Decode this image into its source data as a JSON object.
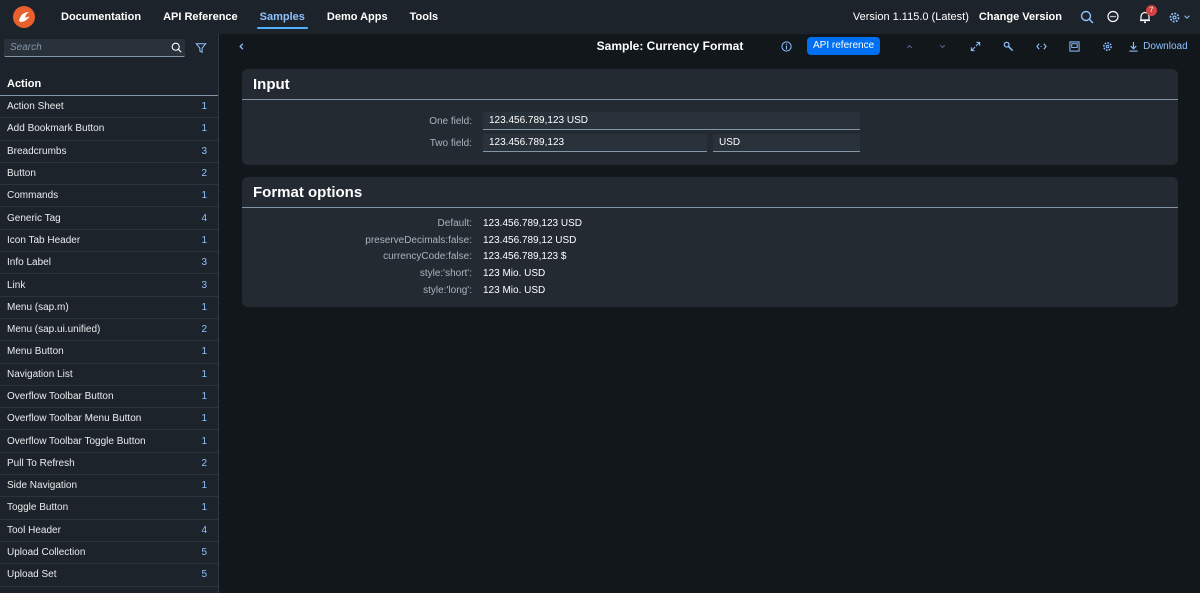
{
  "nav": {
    "items": [
      "Documentation",
      "API Reference",
      "Samples",
      "Demo Apps",
      "Tools"
    ],
    "active_index": 2
  },
  "topbar": {
    "version": "Version 1.115.0 (Latest)",
    "change_version": "Change Version",
    "notification_count": "7",
    "icons": [
      "search-icon",
      "feedback-icon",
      "bell-icon",
      "settings-icon"
    ]
  },
  "sidebar": {
    "search_placeholder": "Search",
    "group": "Action",
    "items": [
      {
        "label": "Action Sheet",
        "count": "1"
      },
      {
        "label": "Add Bookmark Button",
        "count": "1"
      },
      {
        "label": "Breadcrumbs",
        "count": "3"
      },
      {
        "label": "Button",
        "count": "2"
      },
      {
        "label": "Commands",
        "count": "1"
      },
      {
        "label": "Generic Tag",
        "count": "4"
      },
      {
        "label": "Icon Tab Header",
        "count": "1"
      },
      {
        "label": "Info Label",
        "count": "3"
      },
      {
        "label": "Link",
        "count": "3"
      },
      {
        "label": "Menu (sap.m)",
        "count": "1"
      },
      {
        "label": "Menu (sap.ui.unified)",
        "count": "2"
      },
      {
        "label": "Menu Button",
        "count": "1"
      },
      {
        "label": "Navigation List",
        "count": "1"
      },
      {
        "label": "Overflow Toolbar Button",
        "count": "1"
      },
      {
        "label": "Overflow Toolbar Menu Button",
        "count": "1"
      },
      {
        "label": "Overflow Toolbar Toggle Button",
        "count": "1"
      },
      {
        "label": "Pull To Refresh",
        "count": "2"
      },
      {
        "label": "Side Navigation",
        "count": "1"
      },
      {
        "label": "Toggle Button",
        "count": "1"
      },
      {
        "label": "Tool Header",
        "count": "4"
      },
      {
        "label": "Upload Collection",
        "count": "5"
      },
      {
        "label": "Upload Set",
        "count": "5"
      }
    ]
  },
  "sample": {
    "title": "Sample: Currency Format",
    "api_reference": "API reference",
    "download": "Download"
  },
  "input_panel": {
    "title": "Input",
    "one_field_label": "One field:",
    "one_field_value": "123.456.789,123 USD",
    "two_field_label": "Two field:",
    "two_field_amount": "123.456.789,123",
    "two_field_currency": "USD"
  },
  "format_panel": {
    "title": "Format options",
    "rows": [
      {
        "label": "Default:",
        "value": "123.456.789,123 USD"
      },
      {
        "label": "preserveDecimals:false:",
        "value": "123.456.789,12 USD"
      },
      {
        "label": "currencyCode:false:",
        "value": "123.456.789,123 $"
      },
      {
        "label": "style:'short':",
        "value": "123 Mio. USD"
      },
      {
        "label": "style:'long':",
        "value": "123 Mio. USD"
      }
    ]
  },
  "colors": {
    "accent": "#4db1ff",
    "link": "#8fc1ff",
    "button": "#0070f2",
    "badge": "#d04343"
  }
}
